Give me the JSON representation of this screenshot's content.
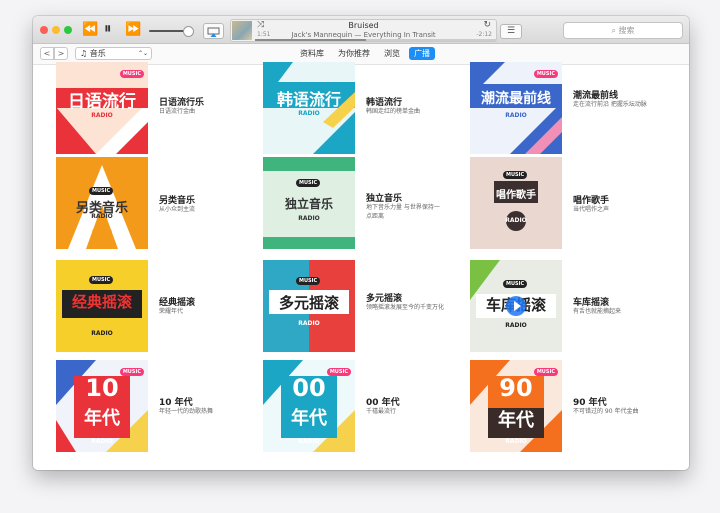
{
  "player": {
    "song": "Bruised",
    "artist_album": "Jack's Mannequin — Everything In Transit",
    "elapsed": "1:51",
    "remaining": "-2:12",
    "progress": 0.46,
    "volume": 0.85,
    "rewind_icon": "⏪",
    "pause_icon": "⏸",
    "forward_icon": "⏩",
    "shuffle_icon": "⤨",
    "repeat_icon": "↻",
    "list_icon": "☰"
  },
  "search": {
    "placeholder": "搜索",
    "icon": "⌕"
  },
  "toolbar": {
    "back": "<",
    "forward": ">",
    "library_selector": "♫ 音乐",
    "selector_arrow": "⌃⌄",
    "tabs": [
      "资料库",
      "为你推荐",
      "浏览",
      "广播"
    ],
    "active_tab": 3
  },
  "stations": [
    {
      "title": "日语流行乐",
      "desc": "日语流行金曲",
      "cover_text": "日语流行"
    },
    {
      "title": "韩语流行",
      "desc": "韩国走红的榜单金曲",
      "cover_text": "韩语流行"
    },
    {
      "title": "潮流最前线",
      "desc": "走在流行前沿 把握乐坛动脉",
      "cover_text": "潮流最前线"
    },
    {
      "title": "另类音乐",
      "desc": "从小众到主流",
      "cover_text": "另类音乐"
    },
    {
      "title": "独立音乐",
      "desc": "地下音乐力量 与世界保持一点距离",
      "cover_text": "独立音乐"
    },
    {
      "title": "唱作歌手",
      "desc": "当代唱作之声",
      "cover_text": "唱作歌手"
    },
    {
      "title": "经典摇滚",
      "desc": "荣耀年代",
      "cover_text": "经典摇滚"
    },
    {
      "title": "多元摇滚",
      "desc": "领略摇滚发展至今的千变万化",
      "cover_text": "多元摇滚"
    },
    {
      "title": "车库摇滚",
      "desc": "有舌也就能摘起来",
      "cover_text": "车库摇滚"
    },
    {
      "title": "10 年代",
      "desc": "年轻一代的劲歌热舞",
      "cover_text_top": "10",
      "cover_text_bottom": "年代"
    },
    {
      "title": "00 年代",
      "desc": "千禧最流行",
      "cover_text_top": "00",
      "cover_text_bottom": "年代"
    },
    {
      "title": "90 年代",
      "desc": "不可错过的 90 年代金曲",
      "cover_text_top": "90",
      "cover_text_bottom": "年代"
    }
  ],
  "badge_text": "MUSIC",
  "radio_label": "RADIO",
  "colors": {
    "accent": "#1e8ef5",
    "badge": "#f8397a"
  }
}
